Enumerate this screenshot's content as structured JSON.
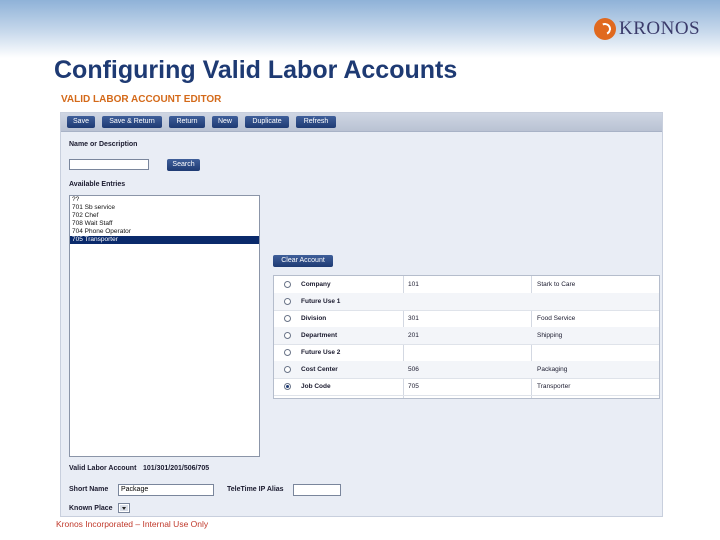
{
  "slide": {
    "title": "Configuring Valid Labor Accounts",
    "footer": "Kronos Incorporated – Internal Use Only",
    "logo_text": "KRONOS"
  },
  "editor": {
    "title": "VALID LABOR ACCOUNT EDITOR",
    "toolbar": [
      "Save",
      "Save & Return",
      "Return",
      "New",
      "Duplicate",
      "Refresh"
    ],
    "search": {
      "label": "Name or Description",
      "value": "",
      "button": "Search"
    },
    "available_entries": {
      "label": "Available Entries",
      "items": [
        "??",
        "701 Sb service",
        "702 Chef",
        "708 Wait Staff",
        "704 Phone Operator",
        "705 Transporter"
      ],
      "selected_index": 5
    },
    "clear_account_button": "Clear Account",
    "levels": [
      {
        "name": "Company",
        "code": "101",
        "desc": "Stark to Care"
      },
      {
        "name": "Future Use 1",
        "code": "",
        "desc": ""
      },
      {
        "name": "Division",
        "code": "301",
        "desc": "Food Service"
      },
      {
        "name": "Department",
        "code": "201",
        "desc": "Shipping"
      },
      {
        "name": "Future Use 2",
        "code": "",
        "desc": ""
      },
      {
        "name": "Cost Center",
        "code": "506",
        "desc": "Packaging"
      },
      {
        "name": "Job Code",
        "code": "705",
        "desc": "Transporter"
      }
    ],
    "selected_level_index": 6,
    "valid_labor_account": {
      "label": "Valid Labor Account",
      "value": "101/301/201/506/705"
    },
    "short_name": {
      "label": "Short Name",
      "value": "Package"
    },
    "teletime": {
      "label": "TeleTime IP Alias",
      "value": ""
    },
    "known_place": {
      "label": "Known Place",
      "value": ""
    },
    "colors": {
      "accent": "#1e3a73",
      "editor_title": "#d46a1a",
      "selection": "#0a2a6b",
      "logo": "#e0691f"
    }
  }
}
